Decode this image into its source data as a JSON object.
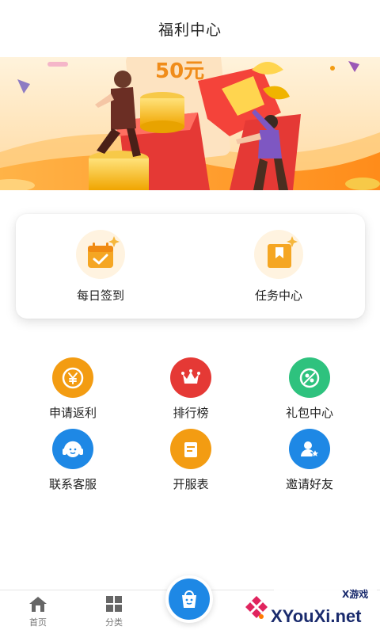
{
  "header": {
    "title": "福利中心"
  },
  "banner": {
    "price_tag": "50元"
  },
  "quick_cards": [
    {
      "label": "每日签到",
      "icon": "calendar-check-icon"
    },
    {
      "label": "任务中心",
      "icon": "bookmark-icon"
    }
  ],
  "grid": [
    {
      "label": "申请返利",
      "icon": "yuan-icon",
      "color": "#f39c12"
    },
    {
      "label": "排行榜",
      "icon": "crown-icon",
      "color": "#e53935"
    },
    {
      "label": "礼包中心",
      "icon": "gift-pack-icon",
      "color": "#2ec27e"
    },
    {
      "label": "联系客服",
      "icon": "headset-icon",
      "color": "#1e88e5"
    },
    {
      "label": "开服表",
      "icon": "list-icon",
      "color": "#f39c12"
    },
    {
      "label": "邀请好友",
      "icon": "invite-user-icon",
      "color": "#1e88e5"
    }
  ],
  "tabbar": {
    "items": [
      {
        "label": "首页",
        "icon": "home-icon"
      },
      {
        "label": "分类",
        "icon": "category-icon"
      }
    ],
    "center_icon": "shopping-bag-icon"
  },
  "watermark": {
    "brand": "XYouXi.net",
    "tag": "X游戏"
  }
}
